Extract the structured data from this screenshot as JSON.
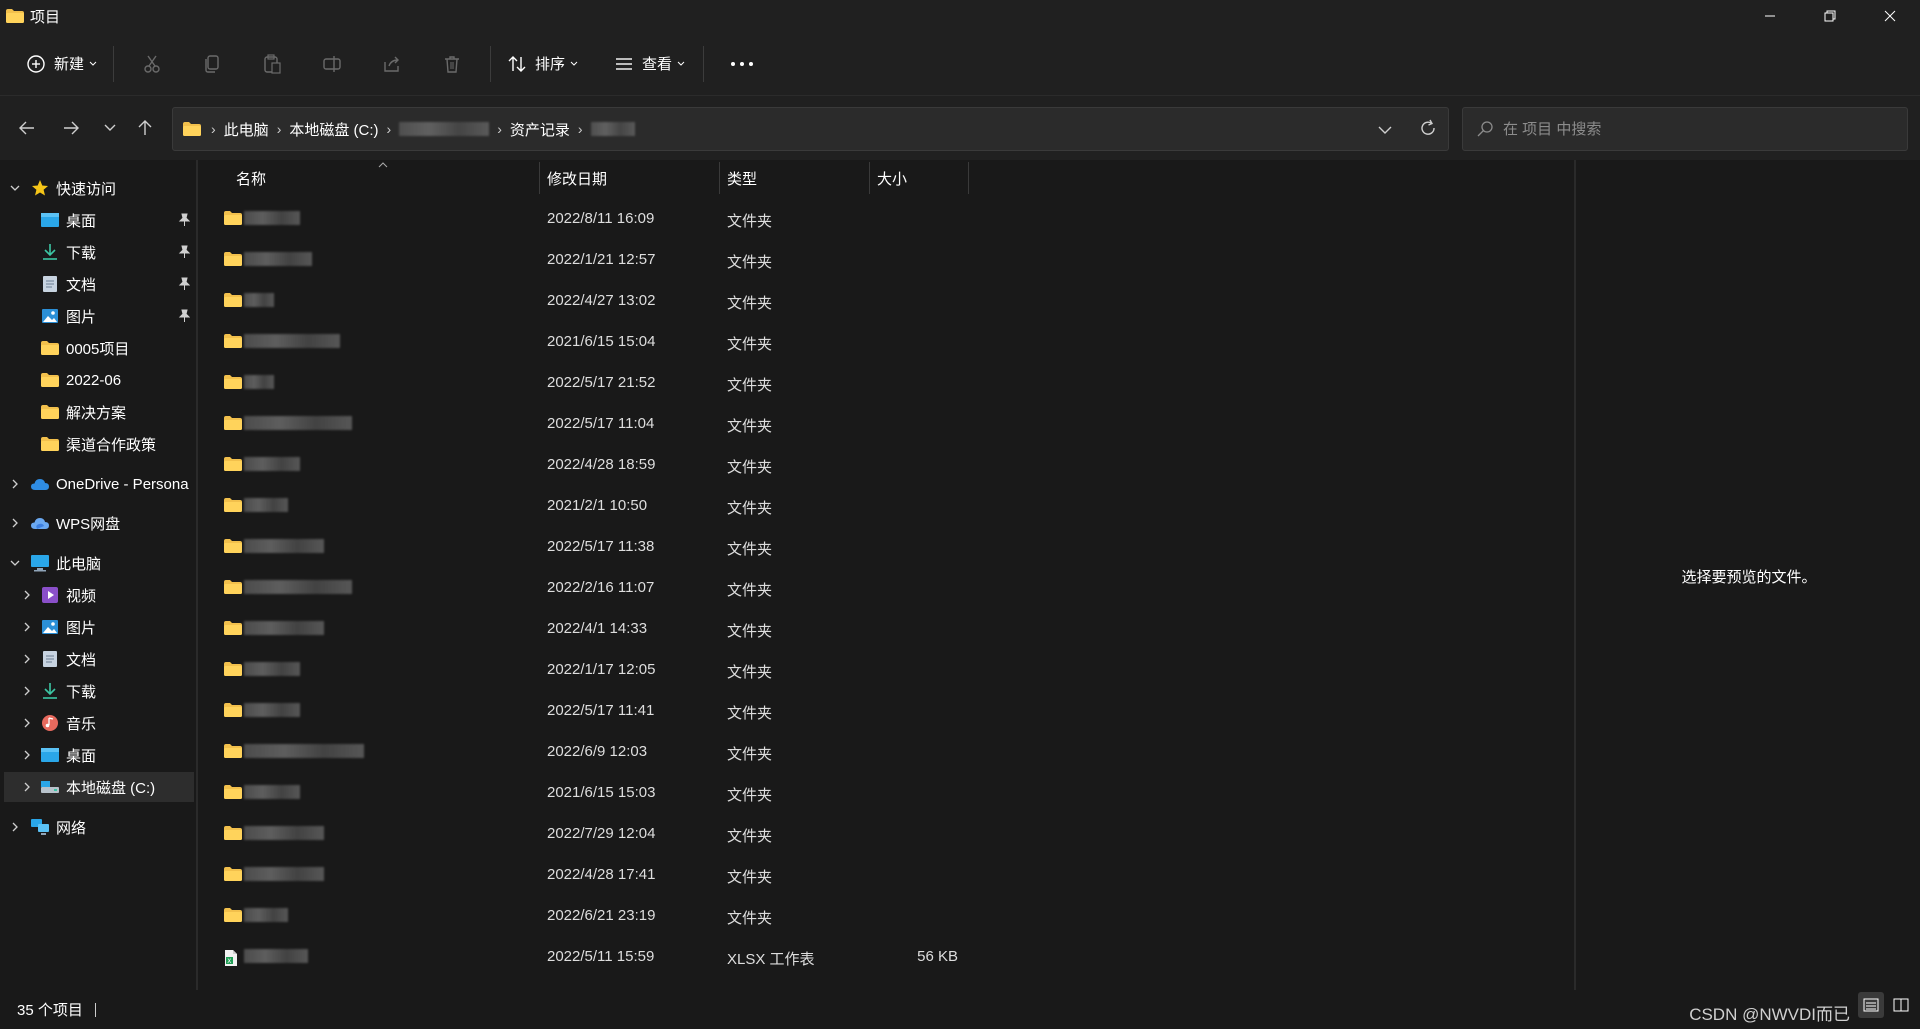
{
  "window": {
    "title": "项目"
  },
  "toolbar": {
    "new_label": "新建",
    "sort_label": "排序",
    "view_label": "查看"
  },
  "breadcrumb": {
    "items": [
      "此电脑",
      "本地磁盘 (C:)",
      "资产记录"
    ]
  },
  "search": {
    "placeholder": "在 项目 中搜索"
  },
  "sidebar": {
    "quick_access": "快速访问",
    "quick_items": [
      "桌面",
      "下载",
      "文档",
      "图片",
      "0005项目",
      "2022-06",
      "解决方案",
      "渠道合作政策"
    ],
    "onedrive": "OneDrive - Persona",
    "wps": "WPS网盘",
    "this_pc": "此电脑",
    "pc_items": [
      "视频",
      "图片",
      "文档",
      "下载",
      "音乐",
      "桌面",
      "本地磁盘 (C:)"
    ],
    "network": "网络"
  },
  "columns": {
    "name": "名称",
    "date": "修改日期",
    "type": "类型",
    "size": "大小"
  },
  "files": [
    {
      "date": "2022/8/11 16:09",
      "type": "文件夹",
      "size": ""
    },
    {
      "date": "2022/1/21 12:57",
      "type": "文件夹",
      "size": ""
    },
    {
      "date": "2022/4/27 13:02",
      "type": "文件夹",
      "size": ""
    },
    {
      "date": "2021/6/15 15:04",
      "type": "文件夹",
      "size": ""
    },
    {
      "date": "2022/5/17 21:52",
      "type": "文件夹",
      "size": ""
    },
    {
      "date": "2022/5/17 11:04",
      "type": "文件夹",
      "size": ""
    },
    {
      "date": "2022/4/28 18:59",
      "type": "文件夹",
      "size": ""
    },
    {
      "date": "2021/2/1 10:50",
      "type": "文件夹",
      "size": ""
    },
    {
      "date": "2022/5/17 11:38",
      "type": "文件夹",
      "size": ""
    },
    {
      "date": "2022/2/16 11:07",
      "type": "文件夹",
      "size": ""
    },
    {
      "date": "2022/4/1 14:33",
      "type": "文件夹",
      "size": ""
    },
    {
      "date": "2022/1/17 12:05",
      "type": "文件夹",
      "size": ""
    },
    {
      "date": "2022/5/17 11:41",
      "type": "文件夹",
      "size": ""
    },
    {
      "date": "2022/6/9 12:03",
      "type": "文件夹",
      "size": ""
    },
    {
      "date": "2021/6/15 15:03",
      "type": "文件夹",
      "size": ""
    },
    {
      "date": "2022/7/29 12:04",
      "type": "文件夹",
      "size": ""
    },
    {
      "date": "2022/4/28 17:41",
      "type": "文件夹",
      "size": ""
    },
    {
      "date": "2022/6/21 23:19",
      "type": "文件夹",
      "size": ""
    },
    {
      "date": "2022/5/11 15:59",
      "type": "XLSX 工作表",
      "size": "56 KB"
    }
  ],
  "preview": {
    "empty_text": "选择要预览的文件。"
  },
  "status": {
    "count": "35 个项目"
  },
  "watermark": "CSDN @NWVDI而已"
}
